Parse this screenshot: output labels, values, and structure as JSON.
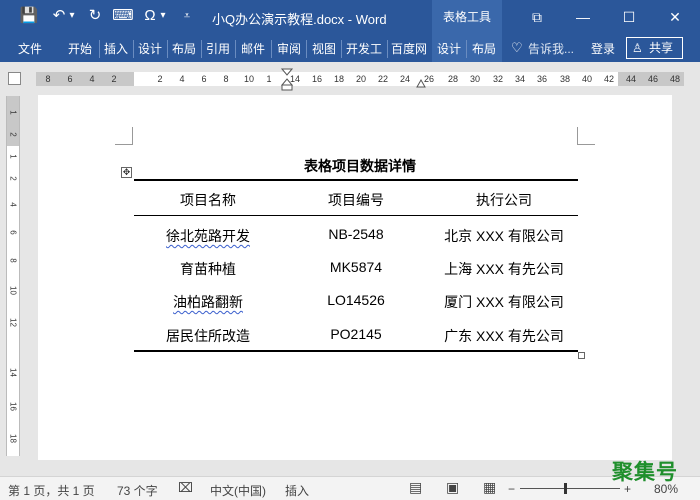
{
  "window": {
    "title": "小Q办公演示教程.docx - Word",
    "context_tools_label": "表格工具",
    "restore_glyph": "⧉",
    "minimize_glyph": "—",
    "maximize_glyph": "☐",
    "close_glyph": "✕"
  },
  "quick_access": {
    "save_glyph": "💾",
    "undo_glyph": "↶",
    "undo_dropdown_glyph": "▾",
    "redo_glyph": "↻",
    "format_glyph": "⌨",
    "omega_glyph": "Ω",
    "omega_dropdown_glyph": "▾",
    "customize_glyph": "⩡"
  },
  "ribbon": {
    "tabs": [
      "文件",
      "开始",
      "插入",
      "设计",
      "布局",
      "引用",
      "邮件",
      "审阅",
      "视图",
      "开发工",
      "百度网",
      "设计",
      "布局"
    ],
    "tell_me": "告诉我...",
    "tell_me_icon": "lightbulb-icon",
    "lightbulb_glyph": "♡",
    "signin": "登录",
    "share": "共享",
    "share_glyph": "♙"
  },
  "ruler": {
    "ticks": [
      "8",
      "6",
      "4",
      "2",
      "",
      "2",
      "4",
      "6",
      "8",
      "10",
      "1",
      "14",
      "16",
      "18",
      "20",
      "22",
      "24",
      "26",
      "28",
      "30",
      "32",
      "34",
      "36",
      "38",
      "40",
      "42",
      "44",
      "46",
      "48"
    ]
  },
  "vruler": {
    "ticks": [
      "1",
      "2",
      "1",
      "2",
      "4",
      "6",
      "8",
      "10",
      "12",
      "14",
      "16",
      "18"
    ]
  },
  "document": {
    "table_title": "表格项目数据详情",
    "move_handle_glyph": "✥",
    "headers": [
      "项目名称",
      "项目编号",
      "执行公司"
    ],
    "rows": [
      [
        "徐北苑路开发",
        "NB-2548",
        "北京 XXX 有限公司"
      ],
      [
        "育苗种植",
        "MK5874",
        "上海 XXX 有先公司"
      ],
      [
        "油柏路翻新",
        "LO14526",
        "厦门 XXX 有限公司"
      ],
      [
        "居民住所改造",
        "PO2145",
        "广东 XXX 有先公司"
      ]
    ]
  },
  "status": {
    "page": "第 1 页，共 1 页",
    "words": "73 个字",
    "proofing_glyph": "⌧",
    "language": "中文(中国)",
    "mode": "插入",
    "read_mode_glyph": "▤",
    "print_layout_glyph": "▣",
    "web_layout_glyph": "▦",
    "zoom_out_glyph": "−",
    "zoom_in_glyph": "+",
    "zoom_level": 0.8,
    "zoom": "80%"
  },
  "watermark": "聚集号",
  "colors": {
    "ribbon_blue": "#2b579a",
    "context_tab": "#3a68ab",
    "watermark_green": "#1f8f2c",
    "spell_underline": "#3a5fcd"
  }
}
